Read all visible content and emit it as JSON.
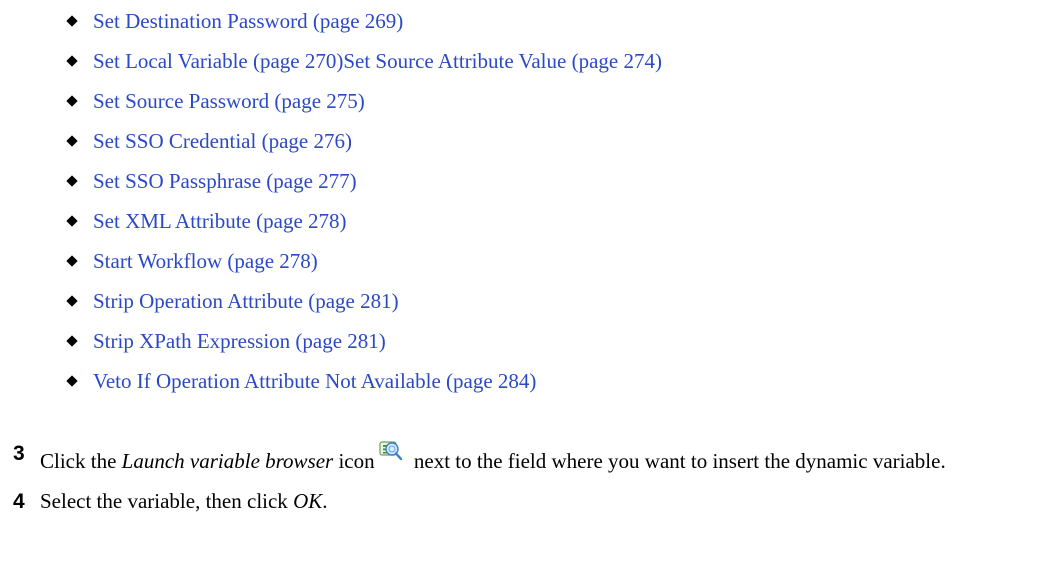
{
  "bullets": [
    {
      "label": "Set Destination Password (page 269)"
    },
    {
      "label": "Set Local Variable (page 270)Set Source Attribute Value (page 274)"
    },
    {
      "label": "Set Source Password (page 275)"
    },
    {
      "label": "Set SSO Credential (page 276)"
    },
    {
      "label": "Set SSO Passphrase (page 277)"
    },
    {
      "label": "Set XML Attribute (page 278)"
    },
    {
      "label": "Start Workflow (page 278)"
    },
    {
      "label": "Strip Operation Attribute (page 281)"
    },
    {
      "label": "Strip XPath Expression (page 281)"
    },
    {
      "label": "Veto If Operation Attribute Not Available (page 284)"
    }
  ],
  "steps": {
    "step3": {
      "number": "3",
      "text_before": "Click the ",
      "emphasis": "Launch variable browser",
      "text_middle": " icon",
      "text_after": " next to the field where you want to insert the dynamic variable.",
      "icon": "launch-variable-browser-icon"
    },
    "step4": {
      "number": "4",
      "text_before": "Select the variable, then click ",
      "emphasis": "OK",
      "text_after": "."
    }
  },
  "colors": {
    "link": "#2a49c7",
    "text": "#000000"
  }
}
